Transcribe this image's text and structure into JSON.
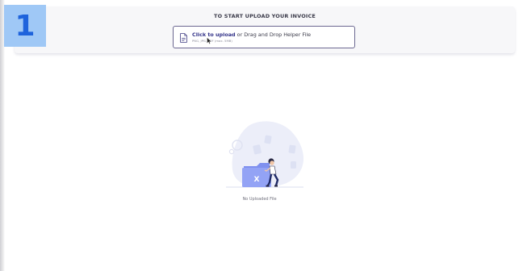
{
  "step": {
    "number": "1"
  },
  "upload": {
    "heading": "TO START UPLOAD YOUR INVOICE",
    "link_text": "Click to upload",
    "rest_text": "or Drag and Drop Helper File",
    "hint": "PNG, JPG, PDF (max. 5MB)"
  },
  "empty_state": {
    "illustration_letter": "X",
    "message": "No Uploaded File"
  },
  "colors": {
    "badge_bg": "#9fc8f6",
    "badge_text": "#1e63dc",
    "link": "#35358a",
    "border": "#6b6790",
    "folder": "#8c9df2"
  }
}
